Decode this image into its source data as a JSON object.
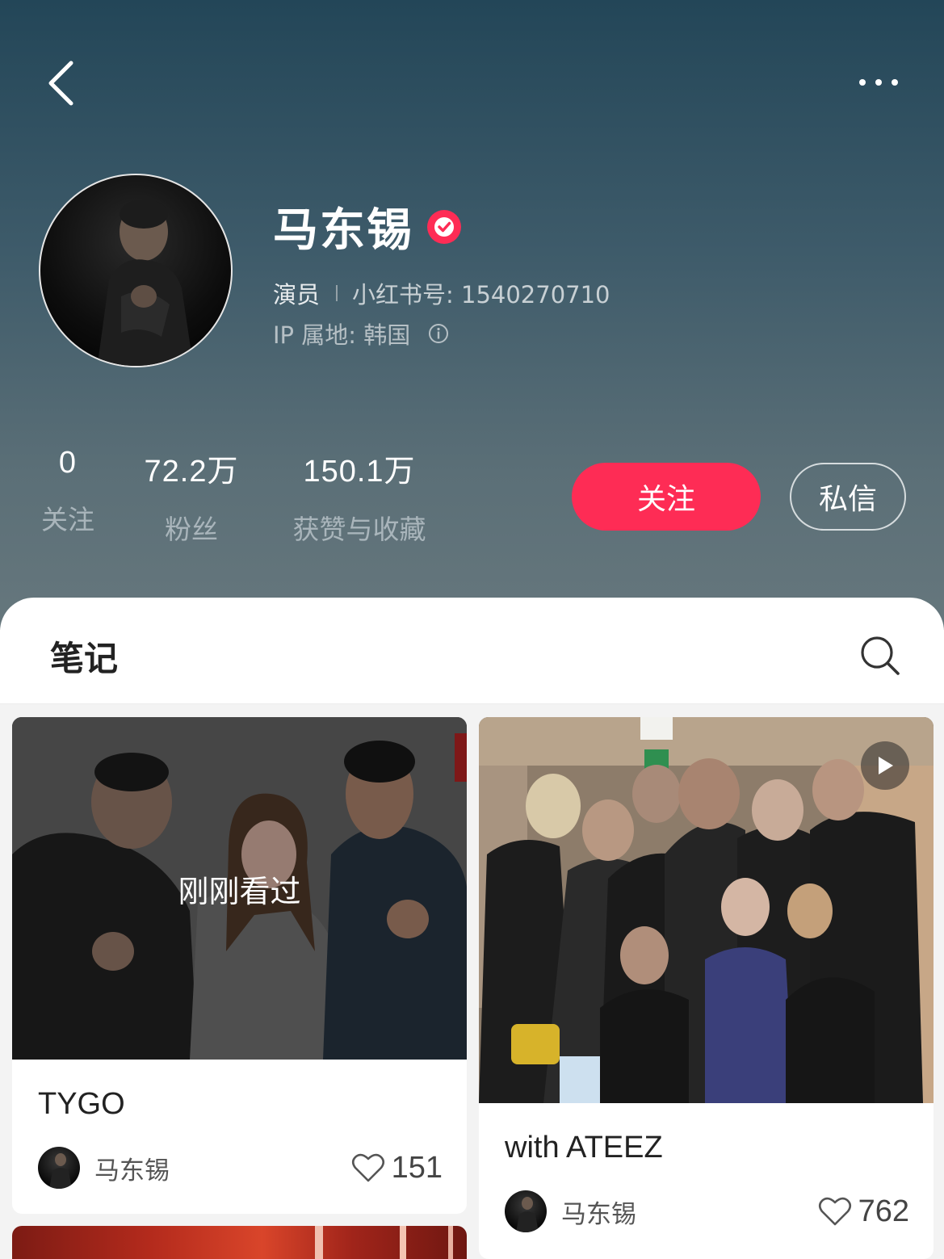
{
  "header": {
    "back_icon": "chevron-left-icon",
    "more_icon": "more-dots-icon"
  },
  "profile": {
    "name": "马东锡",
    "verified_icon": "verified-check-icon",
    "role": "演员",
    "id_label": "小红书号: 1540270710",
    "ip_label": "IP 属地: 韩国",
    "info_icon": "info-icon"
  },
  "stats": [
    {
      "value": "0",
      "label": "关注"
    },
    {
      "value": "72.2万",
      "label": "粉丝"
    },
    {
      "value": "150.1万",
      "label": "获赞与收藏"
    }
  ],
  "actions": {
    "follow_label": "关注",
    "message_label": "私信"
  },
  "tabs": {
    "notes_label": "笔记",
    "search_icon": "search-icon"
  },
  "notes": [
    {
      "title": "TYGO",
      "overlay_text": "刚刚看过",
      "author": "马东锡",
      "likes": "151"
    },
    {
      "title": "with ATEEZ",
      "author": "马东锡",
      "likes": "762",
      "play_icon": "play-icon"
    }
  ],
  "colors": {
    "accent": "#fe2c55",
    "header_top": "#234658",
    "header_bottom": "#66777d"
  }
}
